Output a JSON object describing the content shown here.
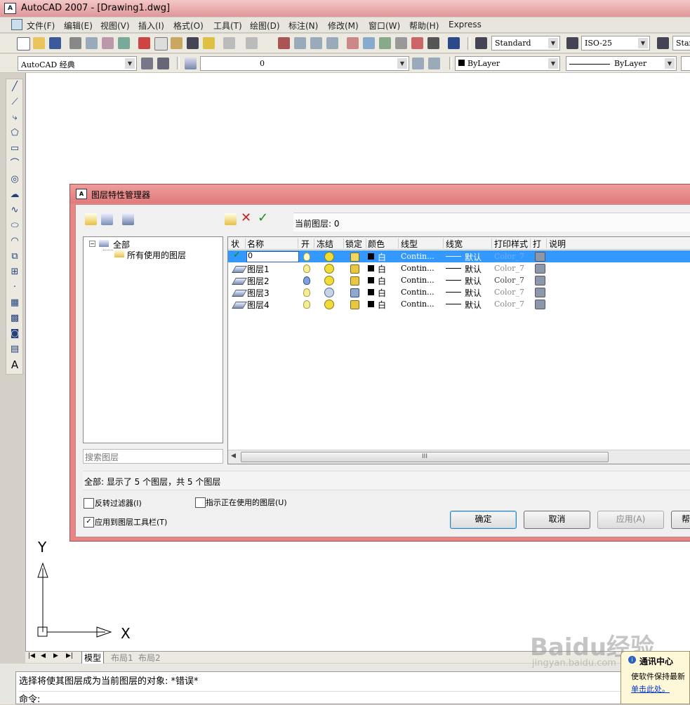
{
  "window": {
    "title": "AutoCAD 2007 - [Drawing1.dwg]"
  },
  "menubar": {
    "items": [
      "文件(F)",
      "编辑(E)",
      "视图(V)",
      "插入(I)",
      "格式(O)",
      "工具(T)",
      "绘图(D)",
      "标注(N)",
      "修改(M)",
      "窗口(W)",
      "帮助(H)",
      "Express"
    ]
  },
  "toolbar": {
    "text_style": "Standard",
    "dim_style": "ISO-25",
    "table_style": "Stan",
    "workspace": "AutoCAD 经典",
    "layer_current": "0",
    "color": "ByLayer",
    "linetype": "ByLayer"
  },
  "dialog": {
    "title": "图层特性管理器",
    "current_layer_label": "当前图层: 0",
    "tree": {
      "root": "全部",
      "child": "所有使用的图层"
    },
    "search_placeholder": "搜索图层",
    "columns": [
      "状",
      "名称",
      "开",
      "冻结",
      "锁定",
      "颜色",
      "线型",
      "线宽",
      "打印样式",
      "打",
      "说明"
    ],
    "layers": [
      {
        "name": "0",
        "color": "白",
        "linetype": "Contin...",
        "lineweight": "默认",
        "plotstyle": "Color_7",
        "current": true
      },
      {
        "name": "图层1",
        "color": "白",
        "linetype": "Contin...",
        "lineweight": "默认",
        "plotstyle": "Color_7",
        "current": false
      },
      {
        "name": "图层2",
        "color": "白",
        "linetype": "Contin...",
        "lineweight": "默认",
        "plotstyle": "Color_7",
        "current": false
      },
      {
        "name": "图层3",
        "color": "白",
        "linetype": "Contin...",
        "lineweight": "默认",
        "plotstyle": "Color_7",
        "current": false
      },
      {
        "name": "图层4",
        "color": "白",
        "linetype": "Contin...",
        "lineweight": "默认",
        "plotstyle": "Color_7",
        "current": false
      }
    ],
    "scroll_grip": "III",
    "summary": "全部: 显示了 5 个图层，共 5 个图层",
    "invert_filter": "反转过滤器(I)",
    "indicate_in_use": "指示正在使用的图层(U)",
    "apply_to_toolbar": "应用到图层工具栏(T)",
    "ok": "确定",
    "cancel": "取消",
    "apply": "应用(A)",
    "help": "帮"
  },
  "ucs": {
    "y": "Y",
    "x": "X"
  },
  "tabs": {
    "model": "模型",
    "layout1": "布局1",
    "layout2": "布局2"
  },
  "command": {
    "line1": "选择将使其图层成为当前图层的对象: *错误*",
    "line2": "命令:"
  },
  "notification": {
    "title": "通讯中心",
    "body": "使软件保持最新",
    "link": "单击此处。"
  },
  "watermark": {
    "brand": "Baidu经验",
    "url": "jingyan.baidu.com"
  }
}
